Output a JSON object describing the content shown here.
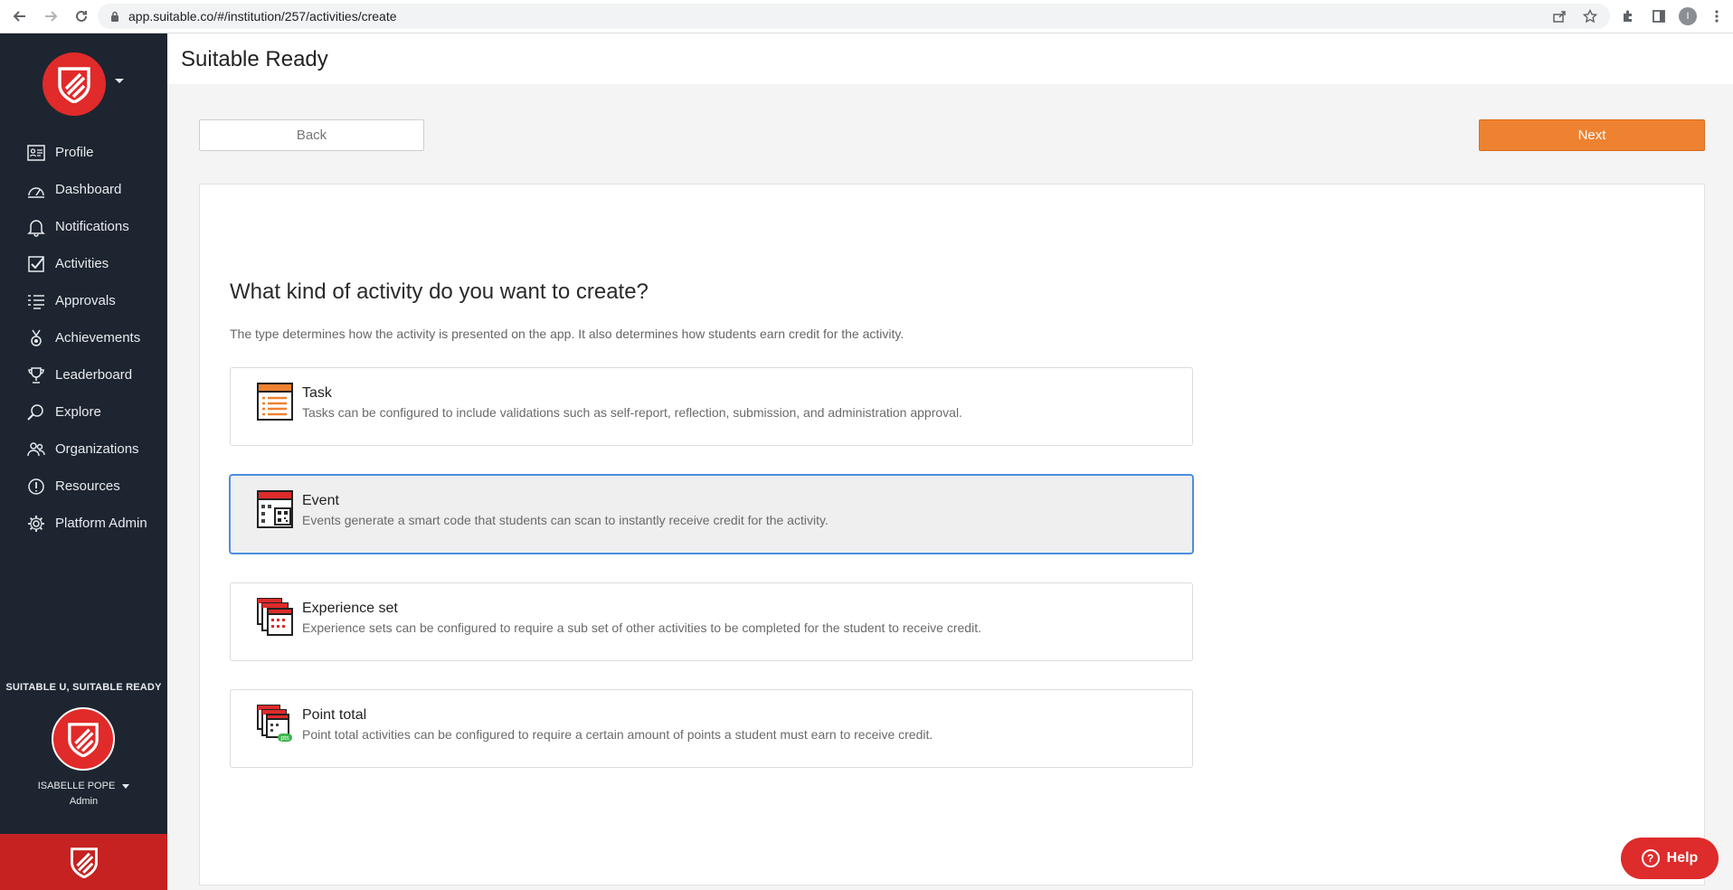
{
  "browser": {
    "url": "app.suitable.co/#/institution/257/activities/create",
    "profile_initial": "I"
  },
  "header": {
    "title": "Suitable Ready"
  },
  "sidebar": {
    "items": [
      {
        "label": "Profile",
        "icon": "profile-card-icon"
      },
      {
        "label": "Dashboard",
        "icon": "dashboard-gauge-icon"
      },
      {
        "label": "Notifications",
        "icon": "bell-icon"
      },
      {
        "label": "Activities",
        "icon": "checkbox-icon"
      },
      {
        "label": "Approvals",
        "icon": "list-check-icon"
      },
      {
        "label": "Achievements",
        "icon": "medal-icon"
      },
      {
        "label": "Leaderboard",
        "icon": "trophy-icon"
      },
      {
        "label": "Explore",
        "icon": "magnifier-icon"
      },
      {
        "label": "Organizations",
        "icon": "people-icon"
      },
      {
        "label": "Resources",
        "icon": "info-icon"
      },
      {
        "label": "Platform Admin",
        "icon": "gear-icon"
      }
    ],
    "institution": "SUITABLE U, SUITABLE READY",
    "user_name": "ISABELLE POPE",
    "user_role": "Admin"
  },
  "actions": {
    "back_label": "Back",
    "next_label": "Next"
  },
  "main": {
    "question": "What kind of activity do you want to create?",
    "helptext": "The type determines how the activity is presented on the app. It also determines how students earn credit for the activity.",
    "options": [
      {
        "title": "Task",
        "desc": "Tasks can be configured to include validations such as self-report, reflection, submission, and administration approval.",
        "selected": false
      },
      {
        "title": "Event",
        "desc": "Events generate a smart code that students can scan to instantly receive credit for the activity.",
        "selected": true
      },
      {
        "title": "Experience set",
        "desc": "Experience sets can be configured to require a sub set of other activities to be completed for the student to receive credit.",
        "selected": false
      },
      {
        "title": "Point total",
        "desc": "Point total activities can be configured to require a certain amount of points a student must earn to receive credit.",
        "selected": false
      }
    ],
    "point_badge": "pts"
  },
  "help": {
    "label": "Help"
  },
  "colors": {
    "accent": "#ef8230",
    "brand": "#e12a2a",
    "sidebar": "#1d2530",
    "selected_border": "#4a8fe0"
  }
}
